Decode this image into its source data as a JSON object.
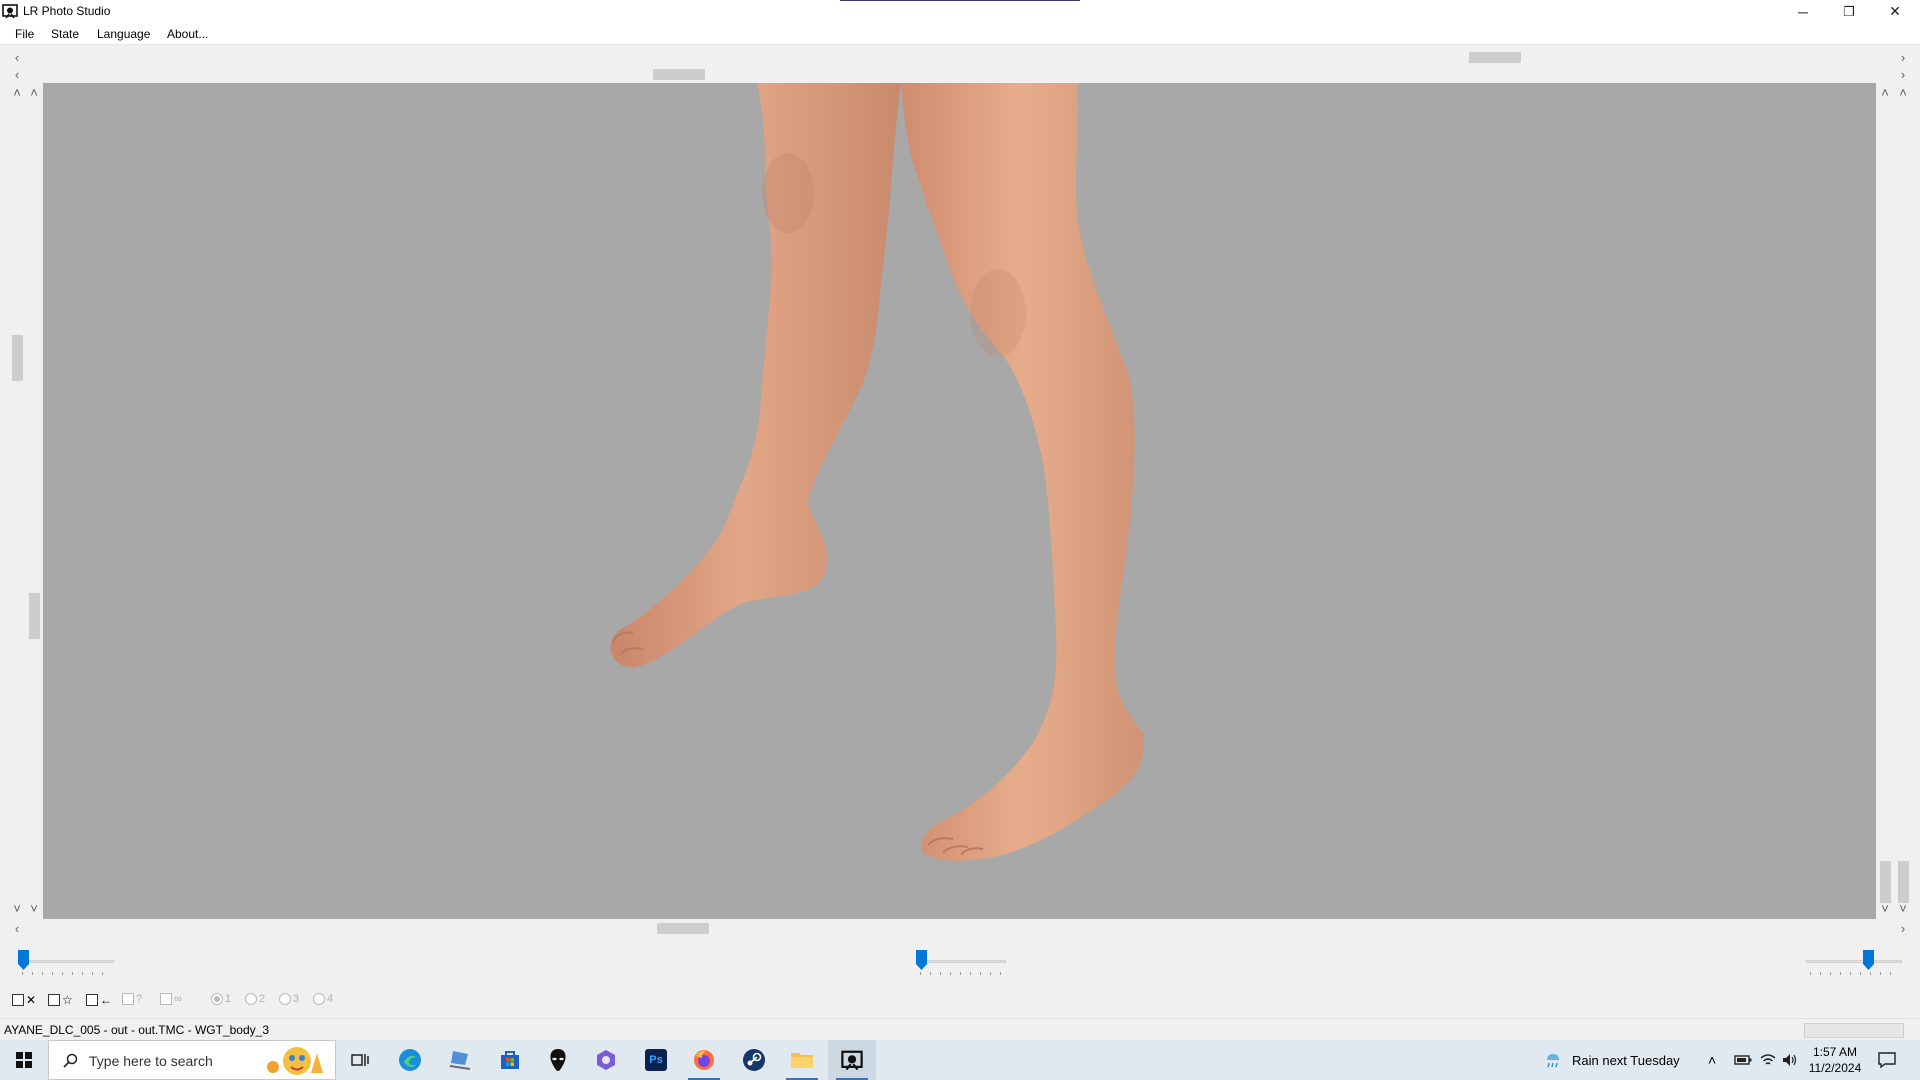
{
  "window": {
    "title": "LR Photo Studio",
    "controls": {
      "minimize": "─",
      "restore": "❐",
      "close": "✕"
    }
  },
  "menu": {
    "items": [
      "File",
      "State",
      "Language",
      "About..."
    ]
  },
  "scroll_arrows": {
    "left": "‹",
    "right": "›",
    "up": "˄",
    "down": "˅"
  },
  "sliders": [
    {
      "id": "left",
      "value": 0.0
    },
    {
      "id": "middle",
      "value": 0.0
    },
    {
      "id": "right",
      "value": 0.67
    }
  ],
  "toolbar": {
    "items": [
      {
        "icon": "checkbox-x-icon",
        "glyph": "✕"
      },
      {
        "icon": "checkbox-star-icon",
        "glyph": "☆"
      },
      {
        "icon": "checkbox-arrow-icon",
        "glyph": "←"
      },
      {
        "icon": "checkbox-question-icon",
        "glyph": "?",
        "disabled": true
      },
      {
        "icon": "checkbox-link-icon",
        "glyph": "∞",
        "disabled": true
      }
    ],
    "radios": [
      "1",
      "2",
      "3",
      "4"
    ],
    "selected_radio": "1"
  },
  "status": {
    "text": "AYANE_DLC_005 - out - out.TMC - WGT_body_3"
  },
  "taskbar": {
    "search_placeholder": "Type here to search",
    "weather": "Rain next Tuesday",
    "time": "1:57 AM",
    "date": "11/2/2024",
    "apps": [
      "task-view-icon",
      "edge-icon",
      "laptop-icon",
      "store-icon",
      "alienware-icon",
      "copilot-icon",
      "photoshop-icon",
      "firefox-icon",
      "steam-icon",
      "file-explorer-icon",
      "lr-photo-studio-icon"
    ],
    "photoshop_label": "Ps"
  },
  "colors": {
    "viewport_bg": "#a8a8a8",
    "slider_knob": "#0078d7",
    "skin": "#d59a78"
  }
}
